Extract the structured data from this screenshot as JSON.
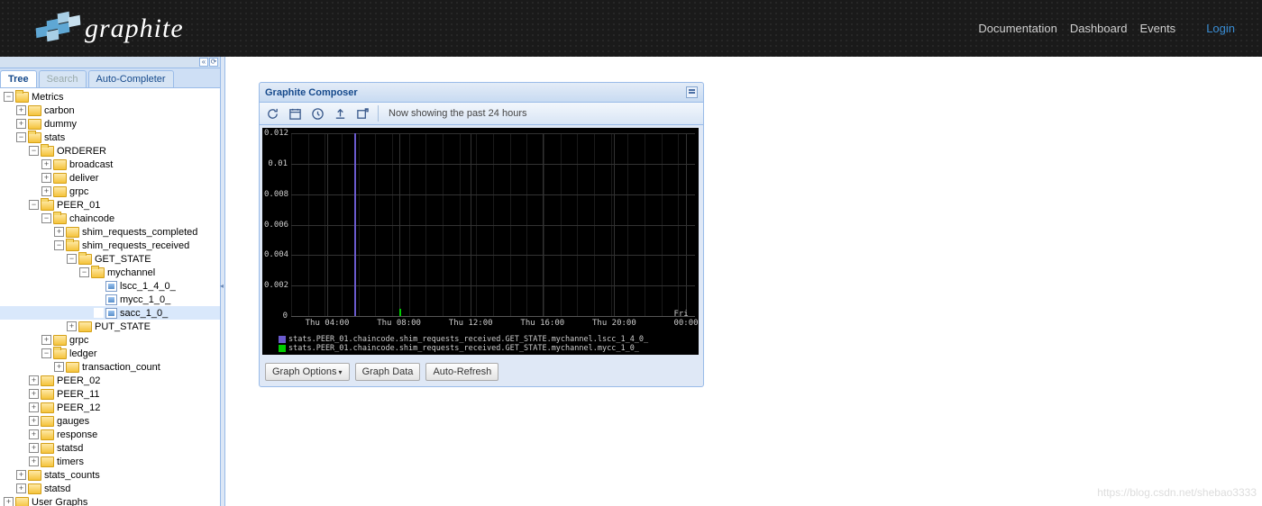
{
  "header": {
    "logo_text": "graphite",
    "nav": {
      "docs": "Documentation",
      "dash": "Dashboard",
      "events": "Events",
      "login": "Login"
    }
  },
  "sidebar": {
    "tabs": {
      "tree": "Tree",
      "search": "Search",
      "auto": "Auto-Completer"
    },
    "tree": {
      "metrics": "Metrics",
      "carbon": "carbon",
      "dummy": "dummy",
      "stats": "stats",
      "orderer": "ORDERER",
      "broadcast": "broadcast",
      "deliver": "deliver",
      "grpc": "grpc",
      "peer01": "PEER_01",
      "chaincode": "chaincode",
      "shim_completed": "shim_requests_completed",
      "shim_received": "shim_requests_received",
      "get_state": "GET_STATE",
      "mychannel": "mychannel",
      "lscc": "lscc_1_4_0_",
      "mycc": "mycc_1_0_",
      "sacc": "sacc_1_0_",
      "put_state": "PUT_STATE",
      "grpc2": "grpc",
      "ledger": "ledger",
      "tx_count": "transaction_count",
      "peer02": "PEER_02",
      "peer11": "PEER_11",
      "peer12": "PEER_12",
      "gauges": "gauges",
      "response": "response",
      "statsd": "statsd",
      "timers": "timers",
      "stats_counts": "stats_counts",
      "statsd2": "statsd",
      "user_graphs": "User Graphs"
    }
  },
  "composer": {
    "title": "Graphite Composer",
    "status": "Now showing the past 24 hours",
    "buttons": {
      "options": "Graph Options",
      "data": "Graph Data",
      "auto": "Auto-Refresh"
    },
    "legend": {
      "a": "stats.PEER_01.chaincode.shim_requests_received.GET_STATE.mychannel.lscc_1_4_0_",
      "b": "stats.PEER_01.chaincode.shim_requests_received.GET_STATE.mychannel.mycc_1_0_"
    }
  },
  "chart_data": {
    "type": "line",
    "ylabel": "",
    "xlabel": "",
    "ylim": [
      0,
      0.012
    ],
    "y_ticks": [
      0,
      0.002,
      0.004,
      0.006,
      0.008,
      0.01,
      0.012
    ],
    "x_ticks": [
      "Thu 04:00",
      "Thu 08:00",
      "Thu 12:00",
      "Thu 16:00",
      "Thu 20:00",
      "Fri 00:00"
    ],
    "series": [
      {
        "name": "stats.PEER_01.chaincode.shim_requests_received.GET_STATE.mychannel.lscc_1_4_0_",
        "color": "#6a5acd",
        "spike_x": "Thu 05:30",
        "spike_y": 0.012
      },
      {
        "name": "stats.PEER_01.chaincode.shim_requests_received.GET_STATE.mychannel.mycc_1_0_",
        "color": "#00cc00",
        "spike_x": "Thu 08:00",
        "spike_y": 0.0005
      }
    ]
  },
  "watermark": "https://blog.csdn.net/shebao3333"
}
